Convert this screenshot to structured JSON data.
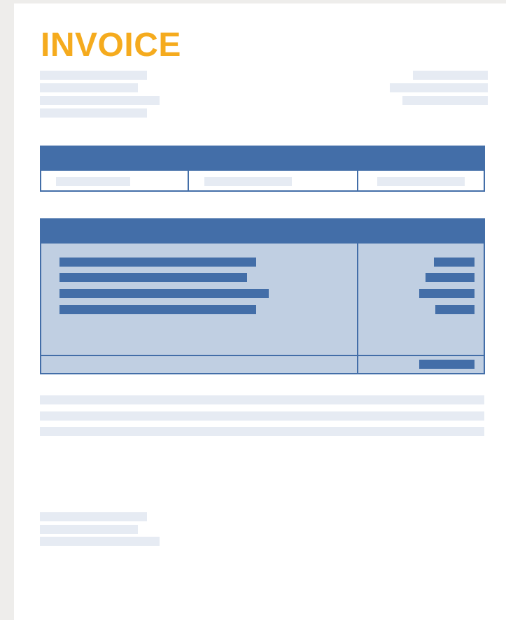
{
  "document": {
    "title": "INVOICE",
    "accent_color": "#f5ab1e",
    "table_color": "#436ea8",
    "table_fill_color": "#c0cfe2",
    "placeholder_color": "#e6ebf3"
  }
}
